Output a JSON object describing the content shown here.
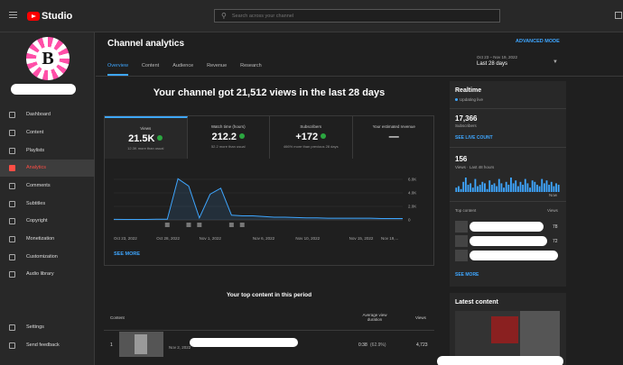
{
  "header": {
    "app_name": "Studio",
    "search_placeholder": "Search across your channel"
  },
  "sidebar": {
    "avatar_letter": "B",
    "items": [
      {
        "label": "Dashboard",
        "icon": "dashboard-icon"
      },
      {
        "label": "Content",
        "icon": "content-icon"
      },
      {
        "label": "Playlists",
        "icon": "playlists-icon"
      },
      {
        "label": "Analytics",
        "icon": "analytics-icon",
        "active": true
      },
      {
        "label": "Comments",
        "icon": "comments-icon"
      },
      {
        "label": "Subtitles",
        "icon": "subtitles-icon"
      },
      {
        "label": "Copyright",
        "icon": "copyright-icon"
      },
      {
        "label": "Monetization",
        "icon": "monetization-icon"
      },
      {
        "label": "Customization",
        "icon": "customization-icon"
      },
      {
        "label": "Audio library",
        "icon": "audio-library-icon"
      }
    ],
    "bottom_items": [
      {
        "label": "Settings",
        "icon": "settings-icon"
      },
      {
        "label": "Send feedback",
        "icon": "feedback-icon"
      }
    ]
  },
  "page": {
    "title": "Channel analytics",
    "advanced_mode": "ADVANCED MODE",
    "tabs": [
      "Overview",
      "Content",
      "Audience",
      "Revenue",
      "Research"
    ],
    "active_tab": "Overview",
    "date_range": {
      "sub": "Oct 23 – Nov 19, 2022",
      "main": "Last 28 days"
    },
    "headline": "Your channel got 21,512 views in the last 28 days"
  },
  "metrics": [
    {
      "label": "Views",
      "value": "21.5K",
      "sub": "12.3K more than usual",
      "up": true
    },
    {
      "label": "Watch time (hours)",
      "value": "212.2",
      "sub": "52.2 more than usual",
      "up": true
    },
    {
      "label": "Subscribers",
      "value": "+172",
      "sub": "466% more than previous 28 days",
      "up": true
    },
    {
      "label": "Your estimated revenue",
      "value": "—",
      "sub": "",
      "up": false
    }
  ],
  "chart_data": {
    "type": "line",
    "x": [
      "Oct 23, 2022",
      "Oct 24",
      "Oct 25",
      "Oct 26",
      "Oct 27",
      "Oct 28, 2022",
      "Oct 29",
      "Oct 30",
      "Oct 31",
      "Nov 1, 2022",
      "Nov 2",
      "Nov 3",
      "Nov 4",
      "Nov 5",
      "Nov 6, 2022",
      "Nov 7",
      "Nov 8",
      "Nov 9",
      "Nov 10, 2022",
      "Nov 11",
      "Nov 12",
      "Nov 13",
      "Nov 14",
      "Nov 15, 2022",
      "Nov 16",
      "Nov 17",
      "Nov 18",
      "Nov 19, 2022"
    ],
    "y": [
      80,
      60,
      60,
      60,
      100,
      100,
      6100,
      5000,
      300,
      3800,
      4700,
      700,
      600,
      600,
      500,
      400,
      400,
      350,
      300,
      300,
      250,
      250,
      250,
      250,
      250,
      200,
      200,
      200
    ],
    "x_tick_labels": [
      "Oct 23, 2022",
      "Oct 28, 2022",
      "Nov 1, 2022",
      "Nov 6, 2022",
      "Nov 10, 2022",
      "Nov 15, 2022",
      "Nov 19,..."
    ],
    "y_ticks": [
      "6.0K",
      "4.0K",
      "2.0K",
      "0"
    ],
    "ylim": [
      0,
      6000
    ],
    "grid": true,
    "color": "#3ea6ff"
  },
  "see_more": "SEE MORE",
  "top_content": {
    "title": "Your top content in this period",
    "col_content": "Content",
    "col_avg": "Average view duration",
    "col_views": "Views",
    "rows": [
      {
        "rank": "1",
        "date": "Nov 2, 2022",
        "avg": "0:38",
        "pct": "(62.9%)",
        "views": "4,723"
      }
    ]
  },
  "realtime": {
    "title": "Realtime",
    "status": "Updating live",
    "subscribers": "17,366",
    "subscribers_label": "Subscribers",
    "live_count_link": "SEE LIVE COUNT",
    "views48": "156",
    "views48_label": "Views · Last 48 hours",
    "now": "Now",
    "bars": [
      3,
      4,
      2,
      7,
      10,
      5,
      6,
      3,
      9,
      4,
      5,
      7,
      6,
      2,
      8,
      5,
      6,
      4,
      9,
      6,
      3,
      7,
      5,
      10,
      6,
      8,
      4,
      7,
      5,
      9,
      6,
      3,
      8,
      7,
      5,
      4,
      9,
      6,
      8,
      5,
      7,
      4,
      6,
      5
    ],
    "top_content_label": "Top content",
    "views_label": "Views",
    "items": [
      {
        "views": "78"
      },
      {
        "views": "72"
      },
      {
        "views": ""
      }
    ],
    "see_more": "SEE MORE"
  },
  "latest": {
    "title": "Latest content"
  }
}
